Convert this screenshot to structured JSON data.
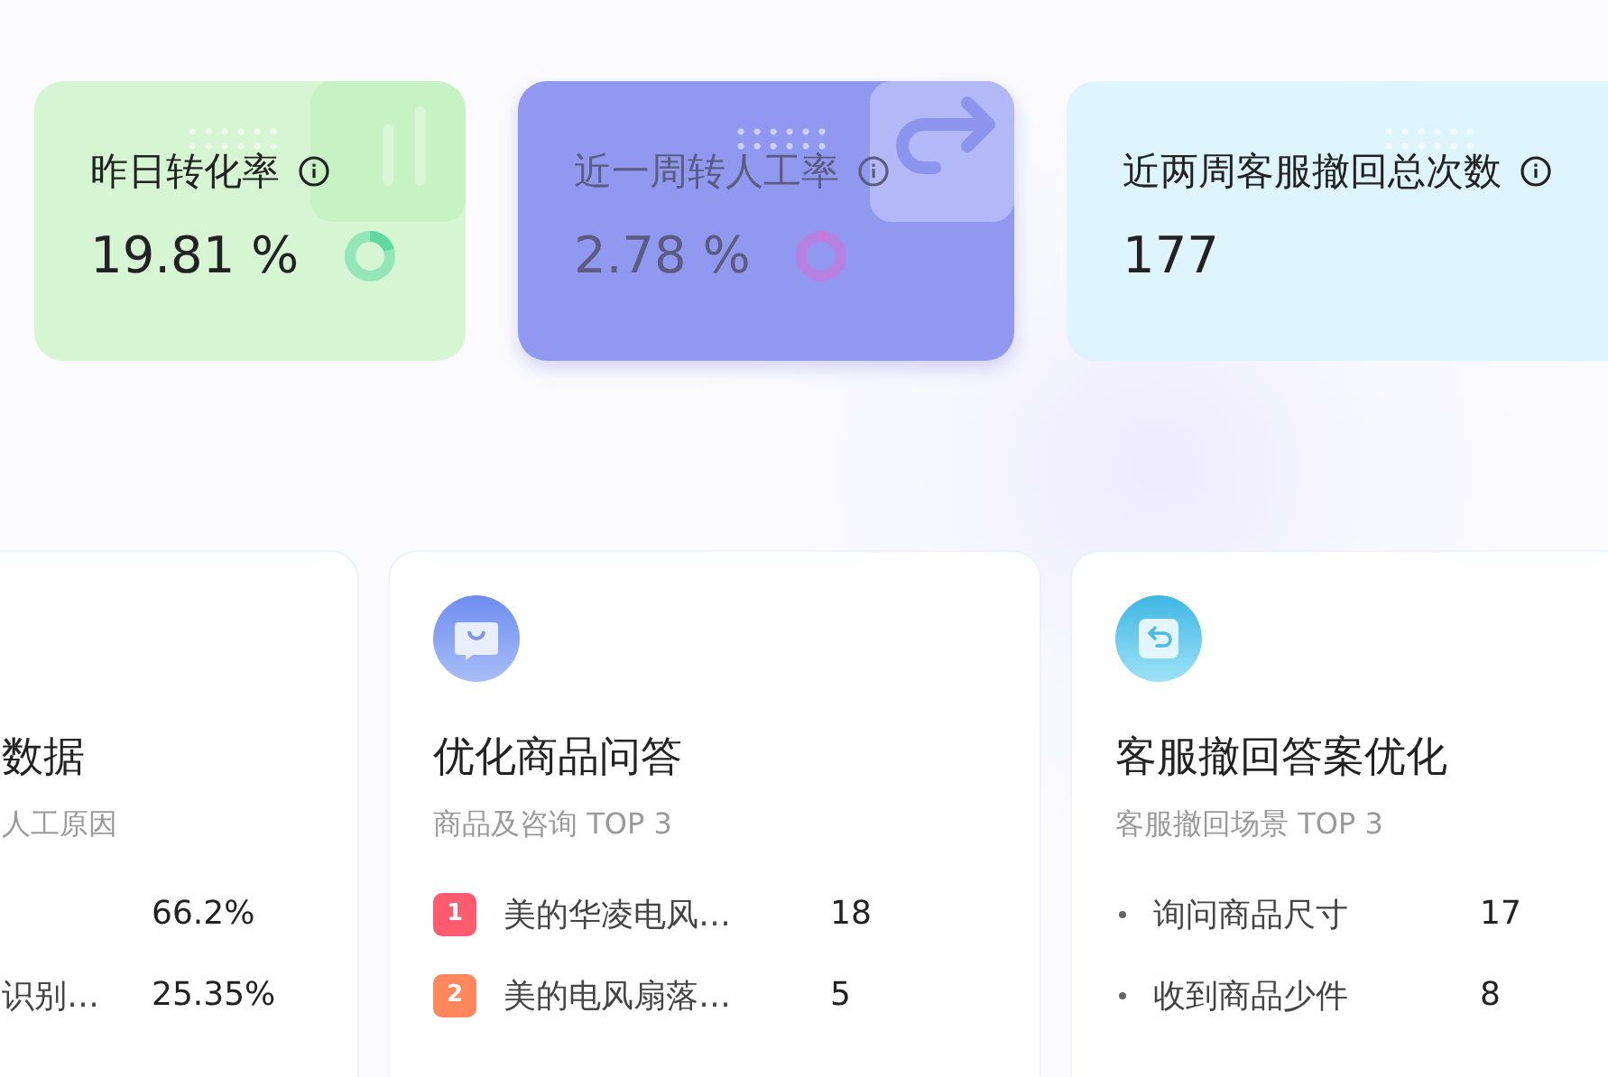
{
  "stat_cards": [
    {
      "title": "昨日转化率",
      "value": "19.81 %",
      "color": "#d6f5d2",
      "kind": "ring",
      "level": 0.1981,
      "dimmed": false
    },
    {
      "title": "近一周转人工率",
      "value": "2.78 %",
      "color": "#9198f0",
      "kind": "ring",
      "level": 0.0278,
      "dimmed": true
    },
    {
      "title": "近两周客服撤回总次数",
      "value": "177",
      "color": "#def5fe",
      "kind": "plain",
      "dimmed": false
    }
  ],
  "panels": [
    {
      "title": "数据",
      "subtitle": "人工原因",
      "items": [
        {
          "kind": "plain",
          "value": "66.2%"
        },
        {
          "kind": "plain",
          "label": "识别…",
          "value": "25.35%"
        }
      ]
    },
    {
      "title": "优化商品问答",
      "subtitle": "商品及咨询 TOP 3",
      "items": [
        {
          "kind": "rank",
          "rank": "1",
          "color": "#ff5b6f",
          "label": "美的华凌电风…",
          "value": "18"
        },
        {
          "kind": "rank",
          "rank": "2",
          "color": "#ff875e",
          "label": "美的电风扇落…",
          "value": "5"
        }
      ]
    },
    {
      "title": "客服撤回答案优化",
      "subtitle": "客服撤回场景 TOP 3",
      "items": [
        {
          "kind": "bullet",
          "label": "询问商品尺寸",
          "value": "17"
        },
        {
          "kind": "bullet",
          "label": "收到商品少件",
          "value": "8"
        }
      ]
    }
  ]
}
